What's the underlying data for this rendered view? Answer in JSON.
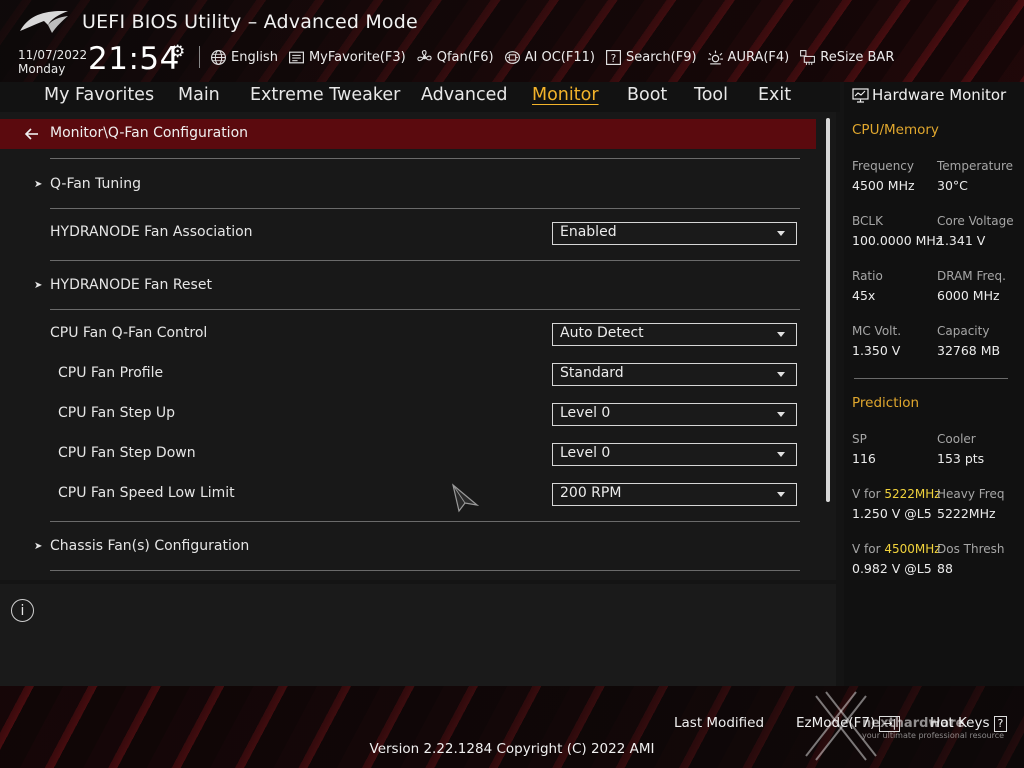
{
  "header": {
    "title": "UEFI BIOS Utility – Advanced Mode",
    "date": "11/07/2022",
    "day": "Monday",
    "time": "21:54",
    "toolbar": [
      {
        "label": "English",
        "icon": "globe-icon"
      },
      {
        "label": "MyFavorite(F3)",
        "icon": "favorite-icon"
      },
      {
        "label": "Qfan(F6)",
        "icon": "fan-icon"
      },
      {
        "label": "AI OC(F11)",
        "icon": "chip-icon"
      },
      {
        "label": "Search(F9)",
        "icon": "search-icon"
      },
      {
        "label": "AURA(F4)",
        "icon": "aura-icon"
      },
      {
        "label": "ReSize BAR",
        "icon": "resize-bar-icon"
      }
    ]
  },
  "tabs": [
    "My Favorites",
    "Main",
    "Extreme Tweaker",
    "Advanced",
    "Monitor",
    "Boot",
    "Tool",
    "Exit"
  ],
  "active_tab": "Monitor",
  "breadcrumb": "Monitor\\Q-Fan Configuration",
  "rows": {
    "qfan_tuning": "Q-Fan Tuning",
    "hydranode_assoc": {
      "label": "HYDRANODE Fan Association",
      "value": "Enabled"
    },
    "hydranode_reset": "HYDRANODE Fan Reset",
    "cpu_qfan_control": {
      "label": "CPU Fan Q-Fan Control",
      "value": "Auto Detect"
    },
    "cpu_fan_profile": {
      "label": "CPU Fan Profile",
      "value": "Standard"
    },
    "cpu_fan_step_up": {
      "label": "CPU Fan Step Up",
      "value": "Level 0"
    },
    "cpu_fan_step_down": {
      "label": "CPU Fan Step Down",
      "value": "Level 0"
    },
    "cpu_fan_speed_low": {
      "label": "CPU Fan Speed Low Limit",
      "value": "200 RPM"
    },
    "chassis_fans": "Chassis Fan(s) Configuration"
  },
  "info_icon": "i",
  "hardware_monitor": {
    "title": "Hardware Monitor",
    "cpu_memory": {
      "section": "CPU/Memory",
      "frequency": {
        "label": "Frequency",
        "value": "4500 MHz"
      },
      "temperature": {
        "label": "Temperature",
        "value": "30°C"
      },
      "bclk": {
        "label": "BCLK",
        "value": "100.0000 MHz"
      },
      "core_voltage": {
        "label": "Core Voltage",
        "value": "1.341 V"
      },
      "ratio": {
        "label": "Ratio",
        "value": "45x"
      },
      "dram_freq": {
        "label": "DRAM Freq.",
        "value": "6000 MHz"
      },
      "mc_volt": {
        "label": "MC Volt.",
        "value": "1.350 V"
      },
      "capacity": {
        "label": "Capacity",
        "value": "32768 MB"
      }
    },
    "prediction": {
      "section": "Prediction",
      "sp": {
        "label": "SP",
        "value": "116"
      },
      "cooler": {
        "label": "Cooler",
        "value": "153 pts"
      },
      "v_for_1_prefix": "V for ",
      "v_for_1_freq": "5222MHz",
      "v_for_1_value": "1.250 V @L5",
      "heavy_freq": {
        "label": "Heavy Freq",
        "value": "5222MHz"
      },
      "v_for_2_prefix": "V for ",
      "v_for_2_freq": "4500MHz",
      "v_for_2_value": "0.982 V @L5",
      "dos_thresh": {
        "label": "Dos Thresh",
        "value": "88"
      }
    }
  },
  "footer": {
    "last_modified": "Last Modified",
    "ezmode": "EzMode(F7)",
    "ezmode_key": "→|",
    "hot_keys": "Hot Keys",
    "hot_keys_key": "?",
    "version": "Version 2.22.1284 Copyright (C) 2022 AMI"
  },
  "watermark": {
    "text": "nexthardware",
    "tagline": "your ultimate professional resource"
  },
  "colors": {
    "accent": "#f3b32a",
    "breadcrumb_bg": "#5b0a0e",
    "highlight": "#f0d23c",
    "section": "#e0a72e"
  }
}
